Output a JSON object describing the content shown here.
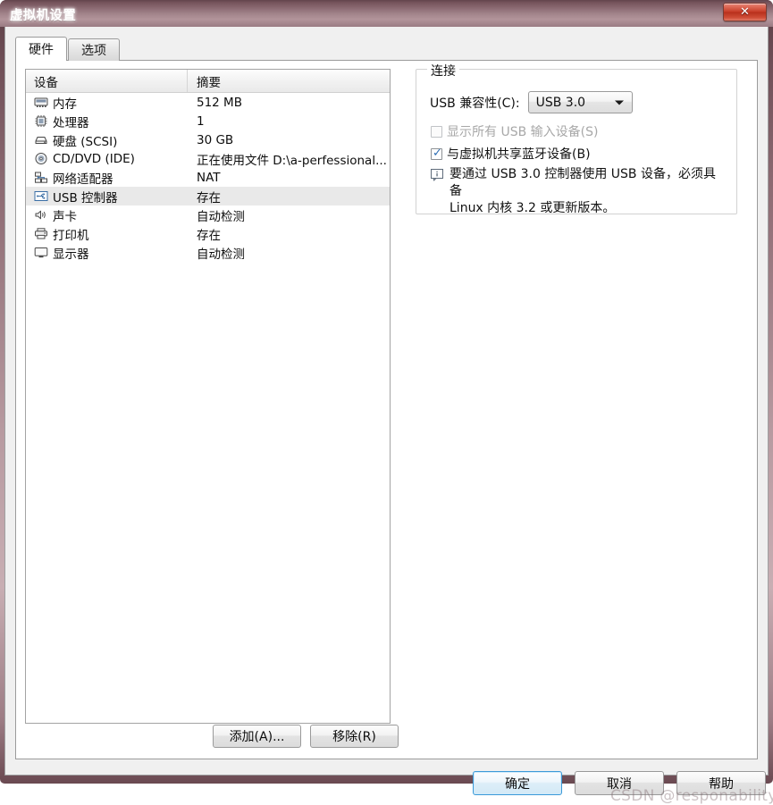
{
  "window": {
    "title": "虚拟机设置",
    "close_label": "✕"
  },
  "tabs": [
    {
      "label": "硬件",
      "active": true
    },
    {
      "label": "选项",
      "active": false
    }
  ],
  "device_list": {
    "columns": [
      "设备",
      "摘要"
    ],
    "rows": [
      {
        "icon": "memory-icon",
        "device": "内存",
        "summary": "512 MB",
        "selected": false
      },
      {
        "icon": "processor-icon",
        "device": "处理器",
        "summary": "1",
        "selected": false
      },
      {
        "icon": "harddisk-icon",
        "device": "硬盘 (SCSI)",
        "summary": "30 GB",
        "selected": false
      },
      {
        "icon": "cddvd-icon",
        "device": "CD/DVD (IDE)",
        "summary": "正在使用文件 D:\\a-perfessional...",
        "selected": false
      },
      {
        "icon": "network-adapter-icon",
        "device": "网络适配器",
        "summary": "NAT",
        "selected": false
      },
      {
        "icon": "usb-controller-icon",
        "device": "USB 控制器",
        "summary": "存在",
        "selected": true
      },
      {
        "icon": "soundcard-icon",
        "device": "声卡",
        "summary": "自动检测",
        "selected": false
      },
      {
        "icon": "printer-icon",
        "device": "打印机",
        "summary": "存在",
        "selected": false
      },
      {
        "icon": "display-icon",
        "device": "显示器",
        "summary": "自动检测",
        "selected": false
      }
    ],
    "add_button": "添加(A)...",
    "remove_button": "移除(R)"
  },
  "connection_group": {
    "title": "连接",
    "compatibility_label": "USB 兼容性(C):",
    "compatibility_value": "USB 3.0",
    "compatibility_options": [
      "USB 3.0"
    ],
    "show_all_usb": {
      "label": "显示所有 USB 输入设备(S)",
      "checked": false,
      "disabled": true
    },
    "share_bluetooth": {
      "label": "与虚拟机共享蓝牙设备(B)",
      "checked": true,
      "disabled": false
    },
    "note": "要通过 USB 3.0 控制器使用 USB 设备，必须具备\nLinux 内核 3.2 或更新版本。"
  },
  "footer": {
    "ok": "确定",
    "cancel": "取消",
    "help": "帮助"
  },
  "watermark": "CSDN @responability",
  "colors": {
    "titlebar": "#8b6a72",
    "close_red": "#c73d28",
    "accent_focus": "#3c9ad8",
    "check_blue": "#2f6fb5",
    "selection": "#e9e9e9",
    "client_bg": "#f0f0f0"
  }
}
